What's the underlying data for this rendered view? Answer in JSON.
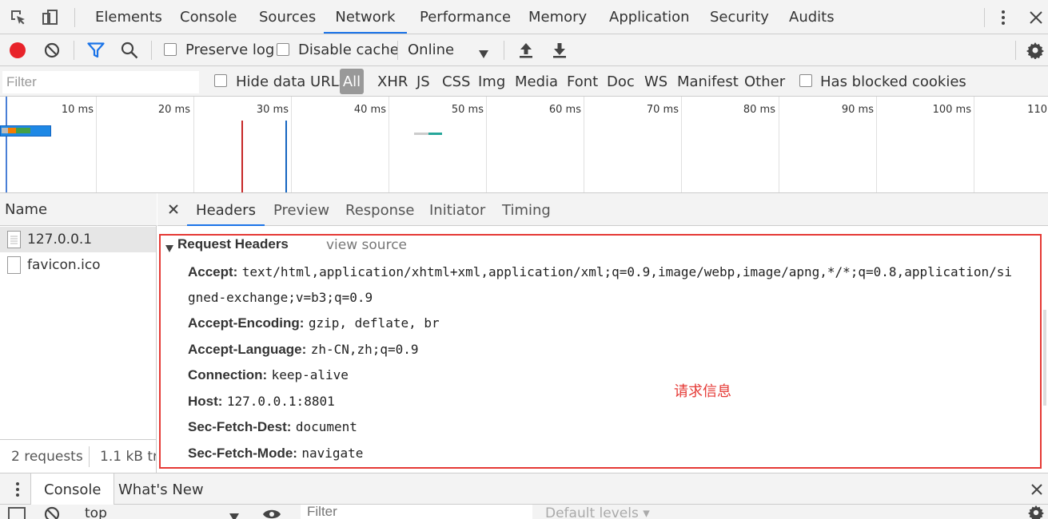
{
  "top_tabs": [
    "Elements",
    "Console",
    "Sources",
    "Network",
    "Performance",
    "Memory",
    "Application",
    "Security",
    "Audits"
  ],
  "active_top_tab": "Network",
  "toolbar": {
    "preserve_log": "Preserve log",
    "disable_cache": "Disable cache",
    "throttle": "Online"
  },
  "filter": {
    "placeholder": "Filter",
    "hide_data_urls": "Hide data URLs",
    "types": [
      "All",
      "XHR",
      "JS",
      "CSS",
      "Img",
      "Media",
      "Font",
      "Doc",
      "WS",
      "Manifest",
      "Other"
    ],
    "has_blocked_cookies": "Has blocked cookies"
  },
  "timeline_ticks": [
    "10 ms",
    "20 ms",
    "30 ms",
    "40 ms",
    "50 ms",
    "60 ms",
    "70 ms",
    "80 ms",
    "90 ms",
    "100 ms",
    "110"
  ],
  "name_panel": {
    "header": "Name",
    "rows": [
      "127.0.0.1",
      "favicon.ico"
    ],
    "status_requests": "2 requests",
    "status_transferred": "1.1 kB tra"
  },
  "detail_tabs": [
    "Headers",
    "Preview",
    "Response",
    "Initiator",
    "Timing"
  ],
  "active_detail_tab": "Headers",
  "request_headers": {
    "title": "Request Headers",
    "view_source": "view source",
    "items": [
      {
        "name": "Accept:",
        "value": "text/html,application/xhtml+xml,application/xml;q=0.9,image/webp,image/apng,*/*;q=0.8,application/si"
      },
      {
        "name": "",
        "value": "gned-exchange;v=b3;q=0.9"
      },
      {
        "name": "Accept-Encoding:",
        "value": "gzip, deflate, br"
      },
      {
        "name": "Accept-Language:",
        "value": "zh-CN,zh;q=0.9"
      },
      {
        "name": "Connection:",
        "value": "keep-alive"
      },
      {
        "name": "Host:",
        "value": "127.0.0.1:8801"
      },
      {
        "name": "Sec-Fetch-Dest:",
        "value": "document"
      },
      {
        "name": "Sec-Fetch-Mode:",
        "value": "navigate"
      }
    ]
  },
  "annotation": "请求信息",
  "drawer": {
    "tabs": [
      "Console",
      "What's New"
    ],
    "context": "top",
    "filter_placeholder": "Filter",
    "levels": "Default levels ▾"
  },
  "colors": {
    "accent": "#1a73e8",
    "record": "#e8232a",
    "annotation": "#e53935"
  }
}
